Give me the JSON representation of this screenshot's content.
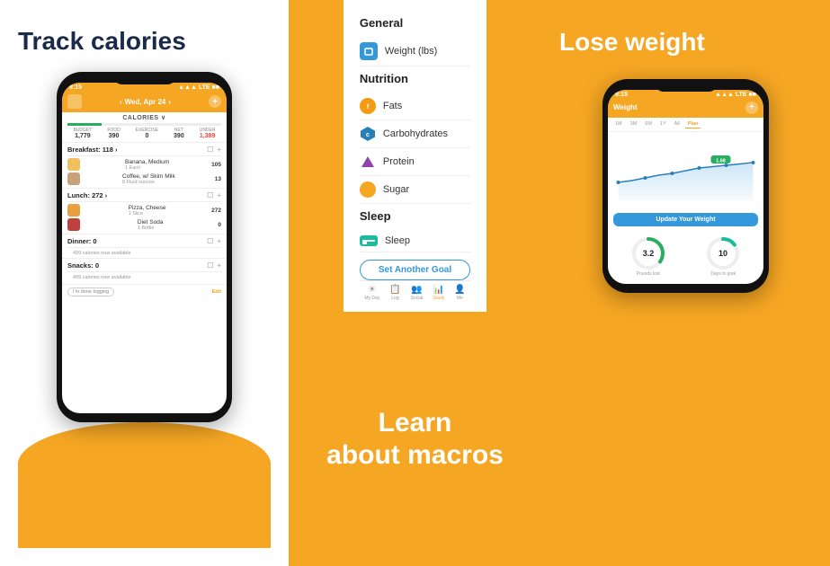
{
  "left": {
    "heading": "Track calories",
    "phone": {
      "status_time": "8:15",
      "status_signal": "▲▲▲",
      "status_lte": "LTE ■■",
      "nav_prev": "<",
      "nav_date": "Wed, Apr 24",
      "nav_next": ">",
      "calories_tab": "CALORIES ∨",
      "macros": [
        {
          "label": "BUDGET",
          "value": "1,779"
        },
        {
          "label": "FOOD",
          "value": "390"
        },
        {
          "label": "EXERCISE",
          "value": "0"
        },
        {
          "label": "NET",
          "value": "390"
        },
        {
          "label": "UNDER",
          "value": "1,389"
        }
      ],
      "meals": [
        {
          "name": "Breakfast: 118 >",
          "foods": [
            {
              "name": "Banana, Medium",
              "qty": "1 Each",
              "cal": "105"
            },
            {
              "name": "Coffee, w/ Skim Milk",
              "qty": "8 Fluid ounces",
              "cal": "13"
            }
          ],
          "avail": ""
        },
        {
          "name": "Lunch: 272 >",
          "foods": [
            {
              "name": "Pizza, Cheese",
              "qty": "1 Slice",
              "cal": "272"
            },
            {
              "name": "Diet Soda",
              "qty": "1 Bottle",
              "cal": "0"
            }
          ],
          "avail": ""
        },
        {
          "name": "Dinner: 0",
          "foods": [],
          "avail": "499 calories now available"
        },
        {
          "name": "Snacks: 0",
          "foods": [],
          "avail": "499 calories now available"
        }
      ],
      "done_label": "I'm done logging",
      "edit_label": "Edit"
    }
  },
  "center": {
    "white_section": {
      "general_title": "General",
      "general_items": [
        {
          "text": "Weight (lbs)"
        }
      ],
      "nutrition_title": "Nutrition",
      "nutrition_items": [
        {
          "text": "Fats"
        },
        {
          "text": "Carbohydrates"
        },
        {
          "text": "Protein"
        },
        {
          "text": "Sugar"
        }
      ],
      "sleep_title": "Sleep",
      "sleep_items": [
        {
          "text": "Sleep"
        }
      ],
      "set_goal_btn": "Set Another Goal"
    },
    "tab_bar": [
      {
        "label": "My Day",
        "active": false
      },
      {
        "label": "Log",
        "active": false
      },
      {
        "label": "Social",
        "active": false
      },
      {
        "label": "Goals",
        "active": true
      },
      {
        "label": "Me",
        "active": false
      }
    ],
    "bottom_heading_line1": "Learn",
    "bottom_heading_line2": "about macros"
  },
  "right": {
    "heading": "Lose weight",
    "phone": {
      "status_time": "8:15",
      "status_lte": "LTE ■■",
      "weight_title": "Weight",
      "chart_tabs": [
        "1M",
        "3M",
        "6M",
        "1Y",
        "All",
        "Plan"
      ],
      "active_tab": "Plan",
      "update_btn": "Update Your Weight",
      "stats": [
        {
          "num": "3.2",
          "label": "Pounds lost"
        },
        {
          "num": "10",
          "label": "Days to goal"
        }
      ]
    }
  }
}
